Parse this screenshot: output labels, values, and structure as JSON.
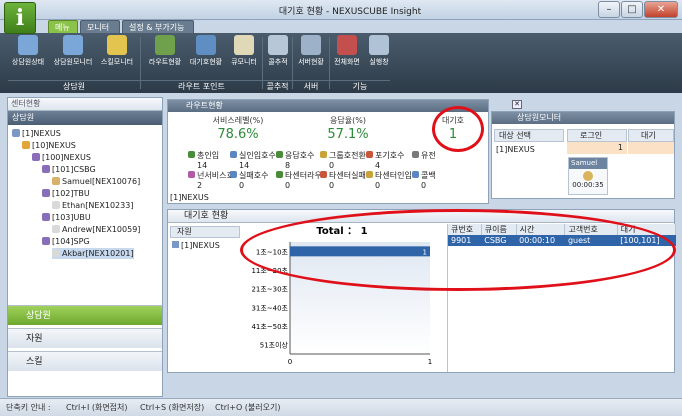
{
  "window": {
    "title": "대기호 현황 - NEXUSCUBE Insight",
    "minimize": "–",
    "maximize": "□",
    "close": "✕"
  },
  "menu_tabs": [
    {
      "label": "메뉴"
    },
    {
      "label": "모니터"
    },
    {
      "label": "설정 & 부가기능"
    }
  ],
  "ribbon": {
    "buttons": [
      {
        "label": "상담원상태",
        "icon": "agent-status-icon",
        "color": "#7aa6d8"
      },
      {
        "label": "상담원모니터",
        "icon": "agent-monitor-icon",
        "color": "#7aa6d8"
      },
      {
        "label": "스킬모니터",
        "icon": "skill-monitor-icon",
        "color": "#e3c44e"
      },
      {
        "label": "라우트현황",
        "icon": "route-status-icon",
        "color": "#6fa04b"
      },
      {
        "label": "대기호현황",
        "icon": "queue-status-icon",
        "color": "#5f8fc2"
      },
      {
        "label": "큐모니터",
        "icon": "queue-monitor-icon",
        "color": "#e0d9b8"
      },
      {
        "label": "콜추적",
        "icon": "call-trace-icon",
        "color": "#b8c7d8"
      },
      {
        "label": "서버현황",
        "icon": "server-status-icon",
        "color": "#9db2c9"
      },
      {
        "label": "전체화면",
        "icon": "fullscreen-icon",
        "color": "#c44f4f"
      },
      {
        "label": "실행창",
        "icon": "run-window-icon",
        "color": "#b0c2d6"
      }
    ],
    "groups": [
      {
        "label": "상담원"
      },
      {
        "label": "라우트 포인트"
      },
      {
        "label": "콜추적"
      },
      {
        "label": "서버"
      },
      {
        "label": "기능"
      }
    ]
  },
  "left": {
    "header": "센터현황",
    "section": "상담원",
    "tree": [
      {
        "label": "[1]NEXUS",
        "color": "#7b99c4"
      },
      {
        "label": "[10]NEXUS",
        "color": "#e3a43a"
      },
      {
        "label": "[100]NEXUS",
        "color": "#8a6db8"
      },
      {
        "label": "[101]CSBG",
        "color": "#8a6db8"
      },
      {
        "label": "Samuel[NEX10076]",
        "color": "#d7b36a"
      },
      {
        "label": "[102]TBU",
        "color": "#8a6db8"
      },
      {
        "label": "Ethan[NEX10233]",
        "color": "#d9d9d9"
      },
      {
        "label": "[103]UBU",
        "color": "#8a6db8"
      },
      {
        "label": "Andrew[NEX10059]",
        "color": "#d9d9d9"
      },
      {
        "label": "[104]SPG",
        "color": "#8a6db8"
      },
      {
        "label": "Akbar[NEX10201]",
        "color": "#d9d9d9"
      }
    ],
    "nav": [
      {
        "label": "상담원"
      },
      {
        "label": "자원"
      },
      {
        "label": "스킬"
      }
    ]
  },
  "route_panel": {
    "title": "라우트현황",
    "service_level_label": "서비스레벨(%)",
    "service_level": "78.6%",
    "answer_rate_label": "응답율(%)",
    "answer_rate": "57.1%",
    "queue_label": "대기호",
    "queue_value": "1",
    "stats": [
      {
        "label": "총인입",
        "value": "14",
        "color": "#4a8b3a"
      },
      {
        "label": "실인입호수",
        "value": "14",
        "color": "#5b86c2"
      },
      {
        "label": "응답호수",
        "value": "8",
        "color": "#4a8b3a"
      },
      {
        "label": "그룹호전환",
        "value": "0",
        "color": "#c9a23a"
      },
      {
        "label": "포기호수",
        "value": "4",
        "color": "#c9563a"
      },
      {
        "label": "유전",
        "value": "",
        "color": "#7a7a7a"
      },
      {
        "label": "넌서비스호수",
        "value": "2",
        "color": "#b05aa8"
      },
      {
        "label": "실패호수",
        "value": "0",
        "color": "#5b86c2"
      },
      {
        "label": "타센터라우팅",
        "value": "0",
        "color": "#4a8b3a"
      },
      {
        "label": "타센터실패",
        "value": "0",
        "color": "#c9563a"
      },
      {
        "label": "타센터인입",
        "value": "0",
        "color": "#c9a23a"
      },
      {
        "label": "콜백",
        "value": "0",
        "color": "#5b86c2"
      }
    ],
    "footer": "[1]NEXUS"
  },
  "agent_monitor": {
    "title": "상담원모니터",
    "select_header": "대상 선택",
    "select_item": "[1]NEXUS",
    "login_label": "로그인",
    "login_value": "1",
    "wait_label": "대기",
    "card_name": "Samuel",
    "card_time": "00:00:35"
  },
  "queue_panel": {
    "title": "대기호 현황",
    "resource_header": "자원",
    "resource_item": "[1]NEXUS",
    "columns": [
      "큐번호",
      "큐이름",
      "시간",
      "고객번호",
      "대기"
    ],
    "rows": [
      [
        "9901",
        "CSBG",
        "00:00:10",
        "guest",
        "[100,101]"
      ]
    ]
  },
  "chart_data": {
    "type": "bar",
    "orientation": "horizontal",
    "title": "Total ： 1",
    "categories": [
      "1초~10초",
      "11초~20초",
      "21초~30초",
      "31초~40초",
      "41초~50초",
      "51초이상"
    ],
    "values": [
      1,
      0,
      0,
      0,
      0,
      0
    ],
    "data_labels": [
      "1"
    ],
    "xlim": [
      0,
      1
    ],
    "xticks": [
      "0",
      "1"
    ],
    "bar_color": "#2f64a8"
  },
  "statusbar": {
    "label": "단축키 안내 :",
    "items": [
      "Ctrl+I (화면접처)",
      "Ctrl+S (화면저장)",
      "Ctrl+O (불러오기)"
    ]
  }
}
